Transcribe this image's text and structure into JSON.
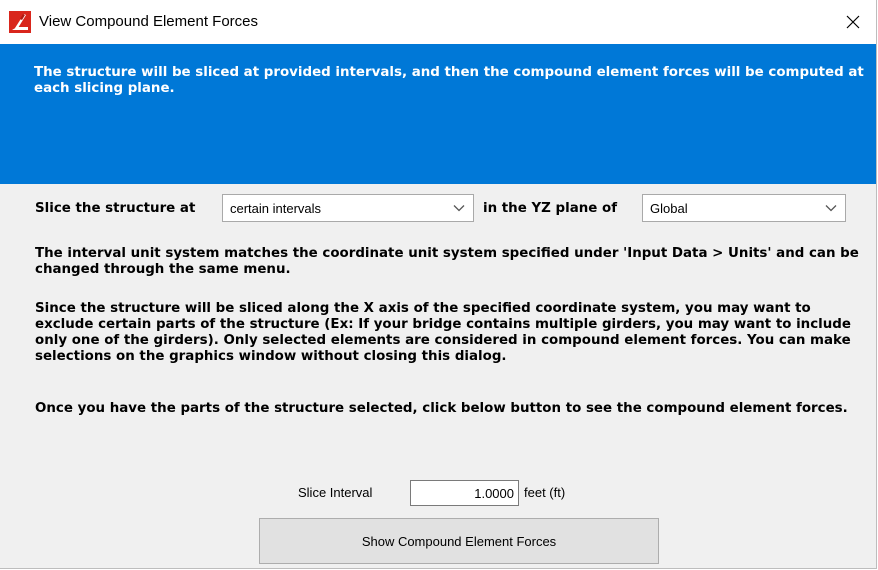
{
  "window": {
    "title": "View Compound Element Forces",
    "icon": "app-logo-icon",
    "close_icon": "close-icon"
  },
  "banner": {
    "text": "The structure will be sliced at provided intervals, and then the compound element forces will be computed at each slicing plane.",
    "color": "#0078d7"
  },
  "slice": {
    "label": "Slice the structure at",
    "method_value": "certain intervals",
    "plane_label": "in the YZ plane of",
    "system_value": "Global"
  },
  "info": {
    "units_note": "The interval unit system matches the coordinate unit system specified under 'Input Data > Units' and can be changed through the same menu.",
    "selection_note": "Since the structure will be sliced along the X axis of the specified coordinate system, you may want to exclude certain parts of the structure (Ex: If your bridge contains multiple girders, you may want to include only one of the girders). Only selected elements are considered in compound element forces. You can make selections on the graphics window without closing this dialog.",
    "action_note": "Once you have the parts of the structure selected, click below button to see the compound element forces."
  },
  "interval": {
    "label": "Slice Interval",
    "value": "1.0000",
    "unit": "feet (ft)"
  },
  "actions": {
    "show_label": "Show Compound Element Forces"
  }
}
